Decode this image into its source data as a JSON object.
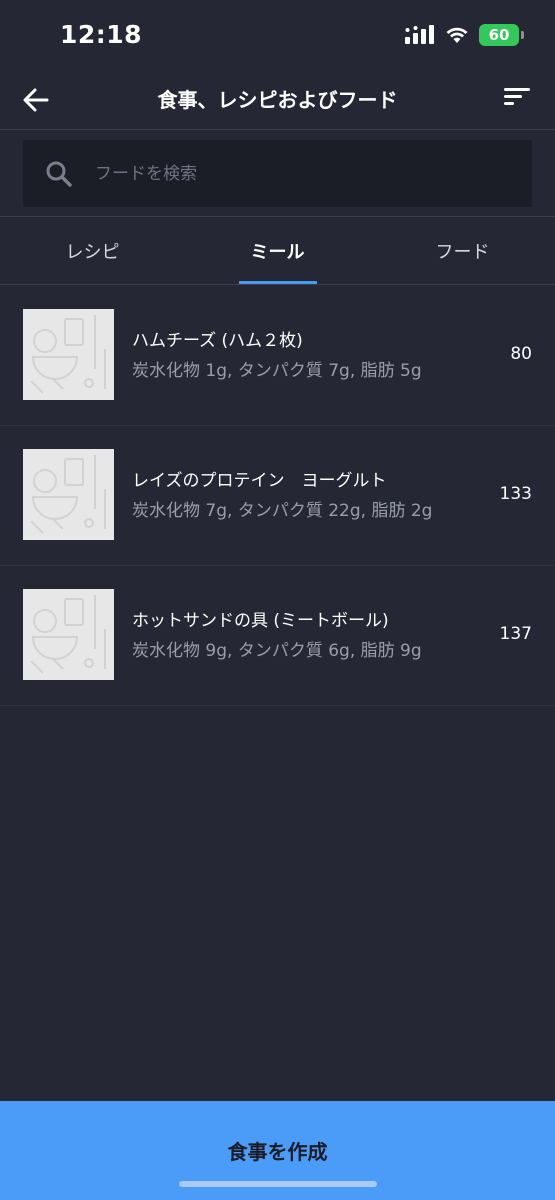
{
  "status_bar": {
    "time": "12:18",
    "battery": "60",
    "icons": [
      "cellular-signal-icon",
      "wifi-icon",
      "battery-charging-icon"
    ]
  },
  "header": {
    "title": "食事、レシピおよびフード",
    "back_icon": "arrow-left-icon",
    "sort_icon": "sort-lines-icon"
  },
  "search": {
    "placeholder": "フードを検索",
    "value": ""
  },
  "tabs": [
    {
      "label": "レシピ",
      "active": false
    },
    {
      "label": "ミール",
      "active": true
    },
    {
      "label": "フード",
      "active": false
    }
  ],
  "meals": [
    {
      "name": "ハムチーズ (ハム２枚)",
      "macros": "炭水化物 1g, タンパク質 7g, 脂肪 5g",
      "calories": "80"
    },
    {
      "name": "レイズのプロテイン　ヨーグルト",
      "macros": "炭水化物 7g, タンパク質 22g, 脂肪 2g",
      "calories": "133"
    },
    {
      "name": "ホットサンドの具 (ミートボール)",
      "macros": "炭水化物 9g, タンパク質 6g, 脂肪 9g",
      "calories": "137"
    }
  ],
  "create_button": {
    "label": "食事を作成"
  },
  "colors": {
    "background": "#252834",
    "accent": "#4b9bf8",
    "tab_indicator": "#4a9af4",
    "battery": "#34c759"
  }
}
